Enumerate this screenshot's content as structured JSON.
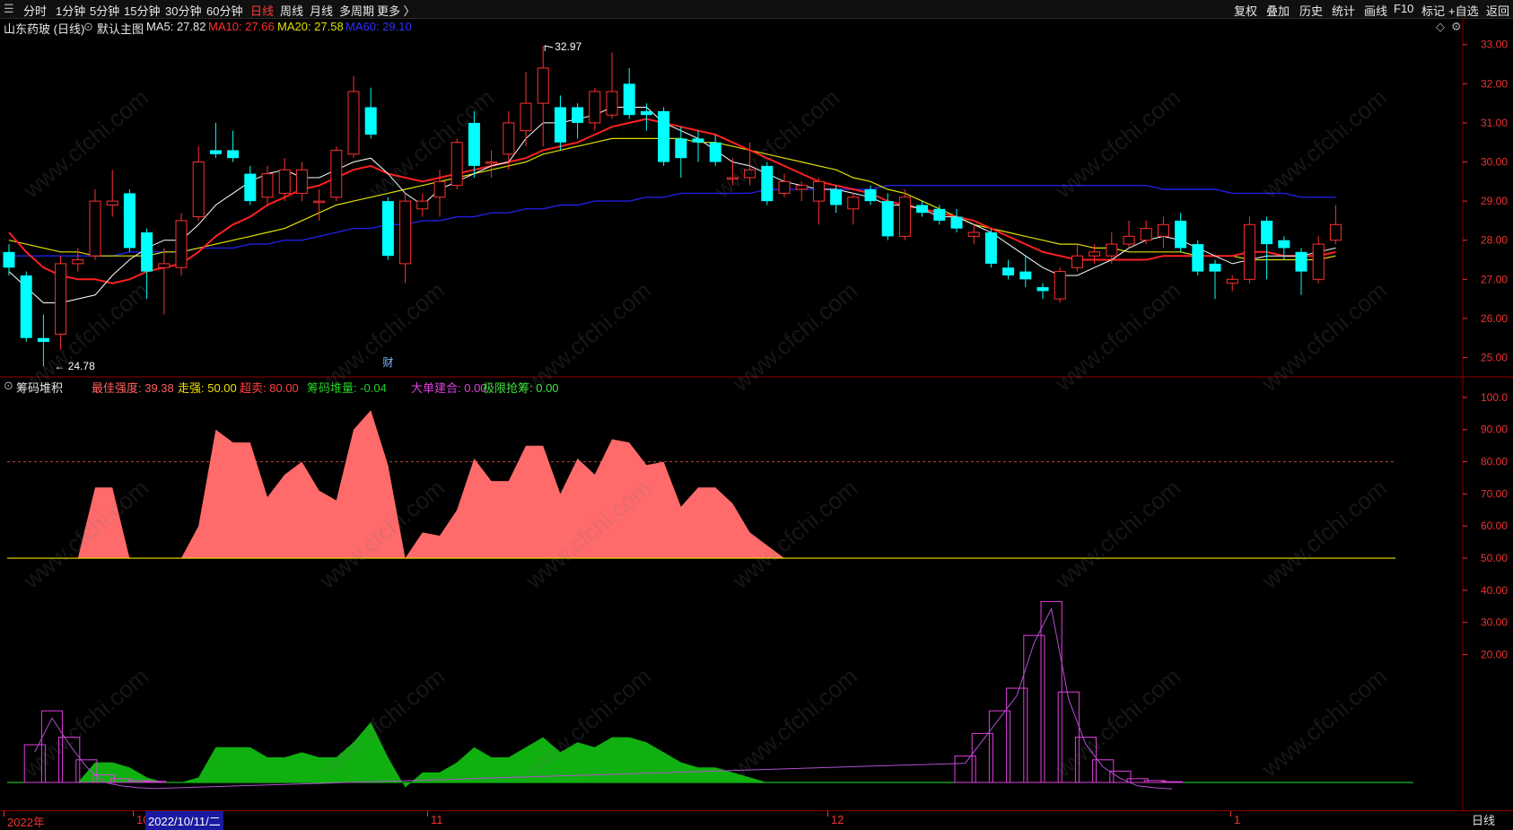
{
  "toolbar": {
    "left_items": [
      {
        "label": "分时"
      },
      {
        "label": "1分钟"
      },
      {
        "label": "5分钟"
      },
      {
        "label": "15分钟"
      },
      {
        "label": "30分钟"
      },
      {
        "label": "60分钟"
      },
      {
        "label": "日线",
        "active": true
      },
      {
        "label": "周线"
      },
      {
        "label": "月线"
      },
      {
        "label": "多周期"
      },
      {
        "label": "更多 〉"
      }
    ],
    "right_items": [
      {
        "label": "复权"
      },
      {
        "label": "叠加"
      },
      {
        "label": "历史"
      },
      {
        "label": "统计"
      },
      {
        "label": "画线"
      },
      {
        "label": "F10"
      },
      {
        "label": "标记"
      },
      {
        "label": "+自选"
      },
      {
        "label": "返回"
      }
    ]
  },
  "main_legend": {
    "stock": "山东药玻 (日线)",
    "template": "默认主图",
    "ma5": "MA5: 27.82",
    "ma10": "MA10: 27.66",
    "ma20": "MA20: 27.58",
    "ma60": "MA60: 29.10"
  },
  "indicator_legend": {
    "name": "筹码堆积",
    "items": [
      {
        "text": "最佳强度: 39.38",
        "color": "#ff6060"
      },
      {
        "text": "走强: 50.00",
        "color": "#f0e000"
      },
      {
        "text": "超卖: 80.00",
        "color": "#ff4040"
      },
      {
        "text": "筹码堆量: -0.04",
        "color": "#20d020"
      },
      {
        "text": "大单建合: 0.00",
        "color": "#e040e0"
      },
      {
        "text": "极限抢筹: 0.00",
        "color": "#40e040"
      }
    ]
  },
  "annotations": {
    "high_label": "32.97",
    "low_label": "24.78",
    "event_mark": "财"
  },
  "bottom": {
    "dates": [
      {
        "text": "2022年"
      },
      {
        "text": "10"
      },
      {
        "text": "11"
      },
      {
        "text": "12"
      },
      {
        "text": "1"
      }
    ],
    "cursor_date": "2022/10/11/二",
    "period": "日线"
  },
  "watermark": "www.cfchi.com",
  "colors": {
    "up": "#ff3030",
    "down": "#00ffff",
    "ma5": "#ffffff",
    "ma10": "#ff2020",
    "ma20": "#e0e000",
    "ma60": "#2020e0",
    "axis": "#ee3333"
  },
  "chart_data": [
    {
      "type": "candlestick",
      "title": "山东药玻 (日线)",
      "y_ticks": [
        "33.00",
        "32.00",
        "31.00",
        "30.00",
        "29.00",
        "28.00",
        "27.00",
        "26.00",
        "25.00"
      ],
      "ylim": [
        24.6,
        33.2
      ],
      "candles": [
        {
          "o": 27.7,
          "c": 27.3,
          "h": 27.9,
          "l": 27.1
        },
        {
          "o": 27.1,
          "c": 25.5,
          "h": 27.2,
          "l": 25.4
        },
        {
          "o": 25.5,
          "c": 25.4,
          "h": 26.1,
          "l": 24.78
        },
        {
          "o": 25.6,
          "c": 27.4,
          "h": 27.6,
          "l": 25.2
        },
        {
          "o": 27.4,
          "c": 27.5,
          "h": 27.8,
          "l": 27.2
        },
        {
          "o": 27.6,
          "c": 29.0,
          "h": 29.3,
          "l": 27.5
        },
        {
          "o": 28.9,
          "c": 29.0,
          "h": 29.8,
          "l": 28.6
        },
        {
          "o": 29.2,
          "c": 27.8,
          "h": 29.3,
          "l": 27.7
        },
        {
          "o": 28.2,
          "c": 27.2,
          "h": 28.3,
          "l": 26.5
        },
        {
          "o": 27.3,
          "c": 27.4,
          "h": 27.8,
          "l": 26.1
        },
        {
          "o": 27.3,
          "c": 28.5,
          "h": 28.7,
          "l": 27.1
        },
        {
          "o": 28.6,
          "c": 30.0,
          "h": 30.4,
          "l": 28.5
        },
        {
          "o": 30.3,
          "c": 30.2,
          "h": 31.0,
          "l": 30.1
        },
        {
          "o": 30.3,
          "c": 30.1,
          "h": 30.8,
          "l": 30.0
        },
        {
          "o": 29.7,
          "c": 29.0,
          "h": 29.9,
          "l": 28.9
        },
        {
          "o": 29.1,
          "c": 29.7,
          "h": 29.9,
          "l": 28.9
        },
        {
          "o": 29.2,
          "c": 29.8,
          "h": 30.1,
          "l": 29.0
        },
        {
          "o": 29.2,
          "c": 29.8,
          "h": 30.0,
          "l": 29.0
        },
        {
          "o": 29.0,
          "c": 29.0,
          "h": 29.3,
          "l": 28.5
        },
        {
          "o": 29.1,
          "c": 30.3,
          "h": 30.4,
          "l": 29.0
        },
        {
          "o": 30.2,
          "c": 31.8,
          "h": 32.2,
          "l": 30.1
        },
        {
          "o": 31.4,
          "c": 30.7,
          "h": 31.9,
          "l": 30.6
        },
        {
          "o": 29.0,
          "c": 27.6,
          "h": 29.1,
          "l": 27.5
        },
        {
          "o": 27.4,
          "c": 29.0,
          "h": 29.2,
          "l": 26.9
        },
        {
          "o": 28.8,
          "c": 29.0,
          "h": 29.2,
          "l": 28.6
        },
        {
          "o": 29.1,
          "c": 29.5,
          "h": 29.8,
          "l": 28.6
        },
        {
          "o": 29.4,
          "c": 30.5,
          "h": 30.6,
          "l": 29.3
        },
        {
          "o": 31.0,
          "c": 29.9,
          "h": 31.3,
          "l": 29.6
        },
        {
          "o": 30.0,
          "c": 30.0,
          "h": 30.3,
          "l": 29.6
        },
        {
          "o": 30.2,
          "c": 31.0,
          "h": 31.3,
          "l": 29.8
        },
        {
          "o": 30.8,
          "c": 31.5,
          "h": 32.3,
          "l": 30.4
        },
        {
          "o": 31.5,
          "c": 32.4,
          "h": 32.97,
          "l": 30.4
        },
        {
          "o": 31.4,
          "c": 30.5,
          "h": 31.7,
          "l": 30.3
        },
        {
          "o": 31.4,
          "c": 31.0,
          "h": 31.5,
          "l": 30.6
        },
        {
          "o": 31.0,
          "c": 31.8,
          "h": 31.9,
          "l": 30.8
        },
        {
          "o": 31.2,
          "c": 31.8,
          "h": 32.8,
          "l": 31.1
        },
        {
          "o": 32.0,
          "c": 31.2,
          "h": 32.4,
          "l": 31.1
        },
        {
          "o": 31.3,
          "c": 31.2,
          "h": 31.5,
          "l": 30.8
        },
        {
          "o": 31.3,
          "c": 30.0,
          "h": 31.4,
          "l": 29.9
        },
        {
          "o": 30.6,
          "c": 30.1,
          "h": 30.9,
          "l": 29.6
        },
        {
          "o": 30.6,
          "c": 30.5,
          "h": 30.8,
          "l": 30.0
        },
        {
          "o": 30.5,
          "c": 30.0,
          "h": 30.7,
          "l": 29.9
        },
        {
          "o": 29.6,
          "c": 29.6,
          "h": 30.1,
          "l": 29.4
        },
        {
          "o": 29.6,
          "c": 29.8,
          "h": 30.5,
          "l": 29.4
        },
        {
          "o": 29.9,
          "c": 29.0,
          "h": 30.0,
          "l": 28.9
        },
        {
          "o": 29.2,
          "c": 29.5,
          "h": 29.7,
          "l": 29.1
        },
        {
          "o": 29.3,
          "c": 29.4,
          "h": 29.5,
          "l": 29.0
        },
        {
          "o": 29.0,
          "c": 29.5,
          "h": 29.6,
          "l": 28.4
        },
        {
          "o": 29.3,
          "c": 28.9,
          "h": 29.4,
          "l": 28.7
        },
        {
          "o": 28.8,
          "c": 29.1,
          "h": 29.2,
          "l": 28.4
        },
        {
          "o": 29.3,
          "c": 29.0,
          "h": 29.4,
          "l": 28.9
        },
        {
          "o": 29.0,
          "c": 28.1,
          "h": 29.2,
          "l": 28.0
        },
        {
          "o": 28.1,
          "c": 29.1,
          "h": 29.3,
          "l": 28.0
        },
        {
          "o": 28.9,
          "c": 28.7,
          "h": 29.0,
          "l": 28.6
        },
        {
          "o": 28.8,
          "c": 28.5,
          "h": 28.9,
          "l": 28.4
        },
        {
          "o": 28.6,
          "c": 28.3,
          "h": 28.8,
          "l": 28.2
        },
        {
          "o": 28.1,
          "c": 28.2,
          "h": 28.4,
          "l": 27.9
        },
        {
          "o": 28.2,
          "c": 27.4,
          "h": 28.3,
          "l": 27.3
        },
        {
          "o": 27.3,
          "c": 27.1,
          "h": 27.5,
          "l": 27.0
        },
        {
          "o": 27.2,
          "c": 27.0,
          "h": 27.6,
          "l": 26.8
        },
        {
          "o": 26.8,
          "c": 26.7,
          "h": 26.9,
          "l": 26.5
        },
        {
          "o": 26.5,
          "c": 27.2,
          "h": 27.3,
          "l": 26.4
        },
        {
          "o": 27.3,
          "c": 27.6,
          "h": 27.9,
          "l": 27.2
        },
        {
          "o": 27.6,
          "c": 27.7,
          "h": 27.9,
          "l": 27.4
        },
        {
          "o": 27.6,
          "c": 27.9,
          "h": 28.2,
          "l": 27.4
        },
        {
          "o": 27.9,
          "c": 28.1,
          "h": 28.5,
          "l": 27.8
        },
        {
          "o": 28.0,
          "c": 28.3,
          "h": 28.5,
          "l": 27.9
        },
        {
          "o": 28.1,
          "c": 28.4,
          "h": 28.6,
          "l": 27.8
        },
        {
          "o": 28.5,
          "c": 27.8,
          "h": 28.7,
          "l": 27.7
        },
        {
          "o": 27.9,
          "c": 27.2,
          "h": 28.0,
          "l": 27.1
        },
        {
          "o": 27.4,
          "c": 27.2,
          "h": 27.5,
          "l": 26.5
        },
        {
          "o": 26.9,
          "c": 27.0,
          "h": 27.1,
          "l": 26.7
        },
        {
          "o": 27.0,
          "c": 28.4,
          "h": 28.6,
          "l": 26.9
        },
        {
          "o": 28.5,
          "c": 27.9,
          "h": 28.6,
          "l": 27.0
        },
        {
          "o": 28.0,
          "c": 27.8,
          "h": 28.1,
          "l": 27.5
        },
        {
          "o": 27.7,
          "c": 27.2,
          "h": 27.8,
          "l": 26.6
        },
        {
          "o": 27.0,
          "c": 27.9,
          "h": 28.1,
          "l": 26.9
        },
        {
          "o": 28.0,
          "c": 28.4,
          "h": 28.9,
          "l": 27.9
        }
      ],
      "ma5": [
        27.2,
        26.8,
        26.4,
        26.4,
        26.5,
        26.6,
        27.1,
        27.5,
        27.8,
        28.0,
        28.0,
        28.4,
        28.9,
        29.2,
        29.5,
        29.7,
        29.8,
        29.6,
        29.6,
        29.8,
        30.0,
        30.1,
        29.7,
        29.2,
        28.9,
        29.3,
        29.5,
        29.7,
        29.9,
        30.0,
        30.6,
        31.0,
        31.0,
        31.1,
        31.2,
        31.4,
        31.4,
        31.4,
        31.0,
        30.8,
        30.6,
        30.3,
        30.0,
        29.9,
        29.7,
        29.5,
        29.4,
        29.3,
        29.3,
        29.2,
        29.1,
        28.9,
        28.9,
        28.8,
        28.6,
        28.6,
        28.4,
        28.2,
        27.9,
        27.6,
        27.3,
        27.1,
        27.1,
        27.3,
        27.5,
        27.8,
        28.0,
        28.1,
        28.0,
        27.8,
        27.6,
        27.4,
        27.5,
        27.6,
        27.6,
        27.6,
        27.7,
        27.8
      ],
      "ma10": [
        28.2,
        27.7,
        27.3,
        27.1,
        27.0,
        27.0,
        26.9,
        27.0,
        27.2,
        27.3,
        27.4,
        27.7,
        28.1,
        28.4,
        28.6,
        28.9,
        29.1,
        29.3,
        29.4,
        29.6,
        29.8,
        29.9,
        29.7,
        29.6,
        29.5,
        29.6,
        29.7,
        29.8,
        29.9,
        30.0,
        30.1,
        30.3,
        30.4,
        30.5,
        30.7,
        30.9,
        31.0,
        31.1,
        31.0,
        30.9,
        30.8,
        30.7,
        30.5,
        30.3,
        30.1,
        29.9,
        29.7,
        29.5,
        29.4,
        29.3,
        29.2,
        29.0,
        28.9,
        28.8,
        28.7,
        28.6,
        28.5,
        28.3,
        28.1,
        27.9,
        27.7,
        27.6,
        27.5,
        27.5,
        27.5,
        27.5,
        27.5,
        27.6,
        27.6,
        27.6,
        27.6,
        27.6,
        27.7,
        27.7,
        27.6,
        27.6,
        27.6,
        27.7
      ],
      "ma20": [
        28.0,
        27.9,
        27.8,
        27.7,
        27.7,
        27.6,
        27.6,
        27.6,
        27.6,
        27.7,
        27.7,
        27.8,
        27.9,
        28.0,
        28.1,
        28.2,
        28.3,
        28.5,
        28.7,
        28.9,
        29.0,
        29.1,
        29.2,
        29.3,
        29.4,
        29.5,
        29.6,
        29.7,
        29.8,
        29.9,
        30.0,
        30.2,
        30.3,
        30.4,
        30.5,
        30.6,
        30.6,
        30.6,
        30.6,
        30.6,
        30.5,
        30.5,
        30.4,
        30.3,
        30.2,
        30.1,
        30.0,
        29.9,
        29.8,
        29.6,
        29.5,
        29.3,
        29.2,
        29.0,
        28.8,
        28.6,
        28.4,
        28.3,
        28.2,
        28.1,
        28.0,
        27.9,
        27.9,
        27.8,
        27.8,
        27.7,
        27.7,
        27.7,
        27.7,
        27.6,
        27.6,
        27.6,
        27.5,
        27.5,
        27.5,
        27.5,
        27.5,
        27.6
      ],
      "ma60": [
        27.6,
        27.6,
        27.6,
        27.6,
        27.6,
        27.6,
        27.6,
        27.7,
        27.7,
        27.7,
        27.7,
        27.8,
        27.8,
        27.8,
        27.9,
        27.9,
        28.0,
        28.0,
        28.1,
        28.2,
        28.3,
        28.3,
        28.4,
        28.4,
        28.5,
        28.5,
        28.6,
        28.6,
        28.7,
        28.7,
        28.8,
        28.8,
        28.9,
        28.9,
        29.0,
        29.0,
        29.0,
        29.1,
        29.1,
        29.2,
        29.2,
        29.2,
        29.2,
        29.2,
        29.3,
        29.3,
        29.3,
        29.3,
        29.3,
        29.3,
        29.3,
        29.4,
        29.4,
        29.4,
        29.4,
        29.4,
        29.4,
        29.4,
        29.4,
        29.4,
        29.4,
        29.4,
        29.4,
        29.4,
        29.4,
        29.4,
        29.4,
        29.3,
        29.3,
        29.3,
        29.3,
        29.2,
        29.2,
        29.2,
        29.2,
        29.1,
        29.1,
        29.1
      ]
    },
    {
      "type": "area",
      "title": "筹码堆积",
      "y_ticks": [
        "100.0",
        "90.00",
        "80.00",
        "70.00",
        "60.00",
        "50.00",
        "40.00",
        "30.00",
        "20.00"
      ],
      "ylim": [
        0,
        105
      ],
      "strength": [
        0,
        0,
        0,
        0,
        0,
        72,
        72,
        50,
        50,
        50,
        50,
        60,
        90,
        86,
        86,
        69,
        76,
        80,
        71,
        68,
        90,
        96,
        79,
        50,
        58,
        57,
        65,
        81,
        74,
        74,
        85,
        85,
        70,
        81,
        76,
        87,
        86,
        79,
        80,
        66,
        72,
        72,
        67,
        58,
        54,
        50,
        0,
        0,
        0,
        0,
        0,
        0,
        0,
        0,
        0,
        0,
        0,
        0,
        0,
        0,
        0,
        0,
        0,
        0,
        0,
        0,
        0,
        0,
        0,
        0,
        0,
        0,
        0,
        0,
        0,
        0,
        0,
        0
      ],
      "accumulation": [
        0,
        0,
        0,
        0,
        0,
        4,
        4,
        3,
        1,
        0,
        0,
        1,
        7,
        7,
        7,
        5,
        5,
        6,
        5,
        5,
        8,
        12,
        5,
        -1,
        2,
        2,
        4,
        7,
        5,
        5,
        7,
        9,
        6,
        8,
        7,
        9,
        9,
        8,
        6,
        4,
        3,
        3,
        2,
        1,
        0,
        0,
        0,
        0,
        0,
        0,
        0,
        0,
        0,
        0,
        0,
        0,
        0,
        0,
        0,
        0,
        0,
        0,
        0,
        0,
        0,
        0,
        0,
        0,
        0,
        0,
        0,
        0,
        0,
        0,
        0,
        0,
        0,
        0
      ],
      "chips": [
        0,
        10,
        19,
        12,
        6,
        2,
        1,
        0.5,
        0.3,
        0,
        0,
        0,
        0,
        0,
        0,
        0,
        0,
        0,
        0,
        0,
        0,
        0,
        0,
        0,
        0,
        0,
        0,
        0,
        0,
        0,
        0,
        0,
        0,
        0,
        0,
        0,
        0,
        0,
        0,
        0,
        0,
        0,
        0,
        0,
        0,
        0,
        0,
        0,
        0,
        0,
        0,
        0,
        0,
        0,
        0,
        7,
        13,
        19,
        25,
        39,
        48,
        24,
        12,
        6,
        3,
        1,
        0.5,
        0.2,
        0,
        0,
        0,
        0,
        0,
        0,
        0,
        0,
        0,
        0
      ],
      "overbought": 80,
      "baseline": 50
    }
  ]
}
